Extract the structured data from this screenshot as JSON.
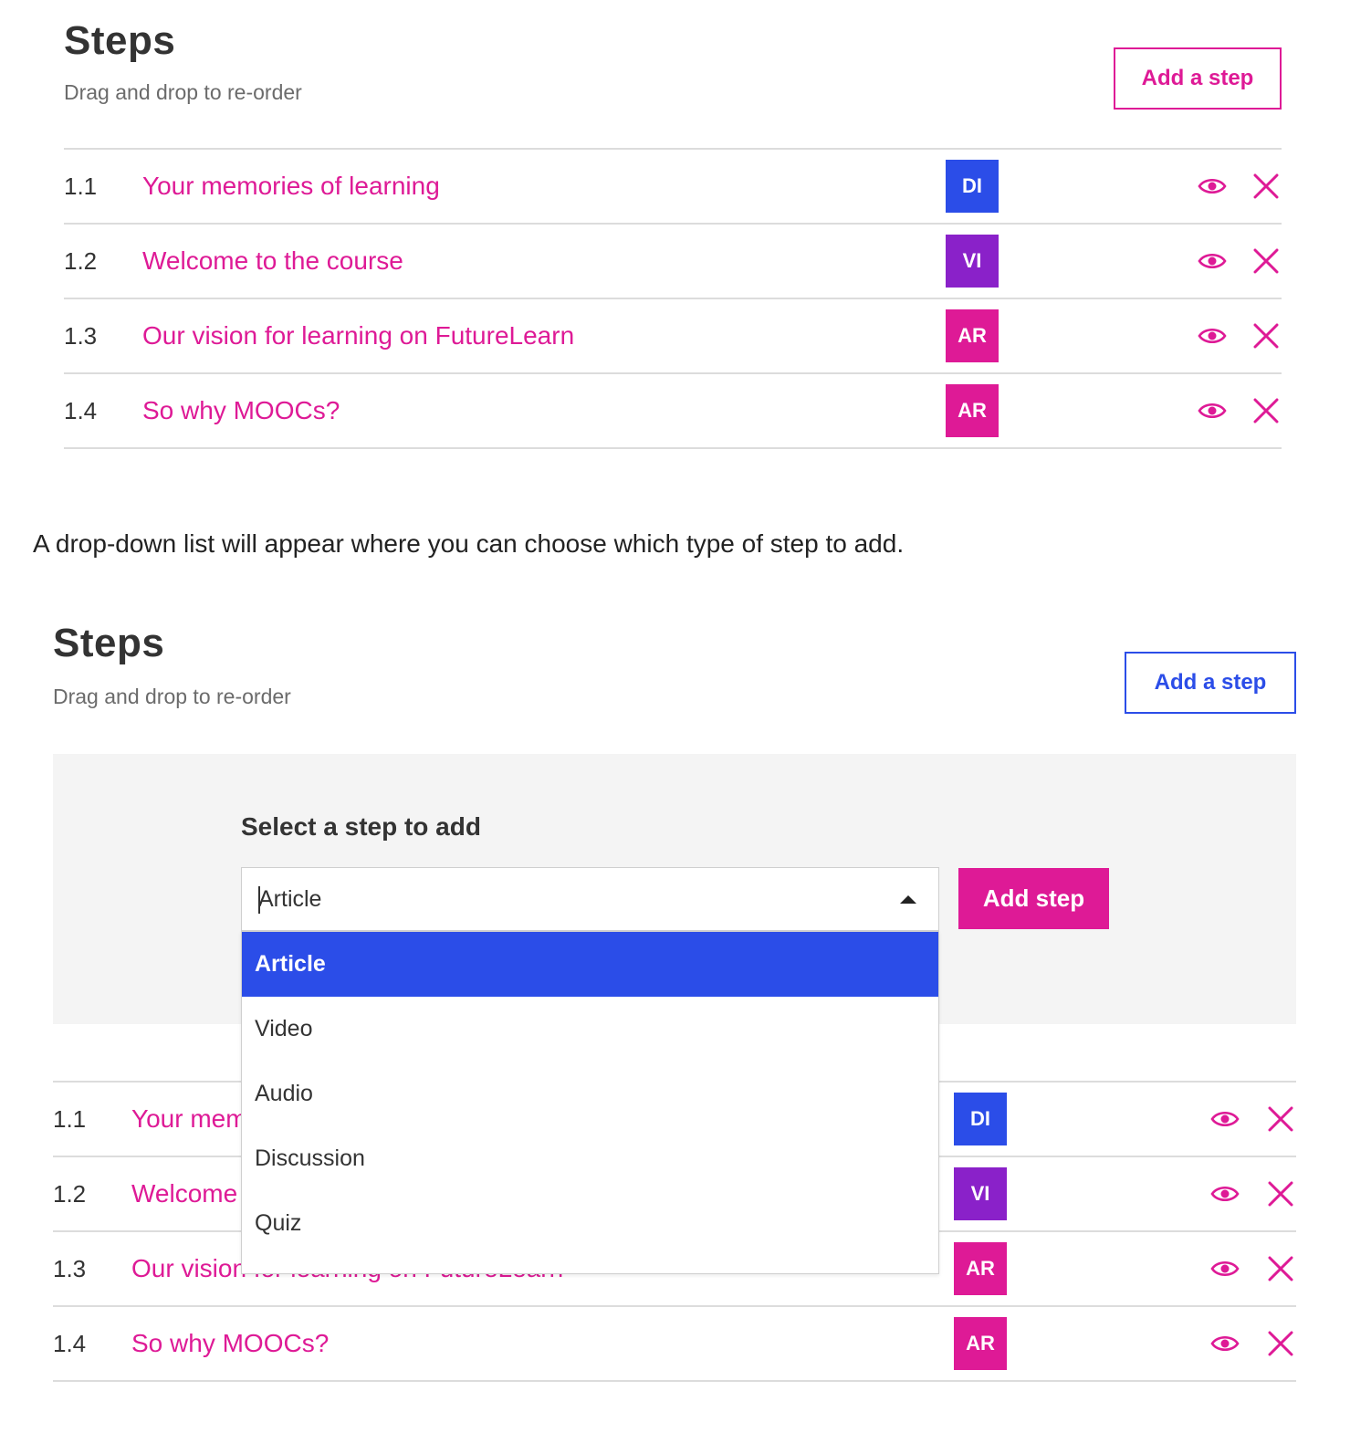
{
  "panel1": {
    "title": "Steps",
    "subtitle": "Drag and drop to re-order",
    "add_button": "Add a step",
    "add_button_color": "#de1a96",
    "steps": [
      {
        "num": "1.1",
        "title": "Your memories of learning",
        "badge": "DI",
        "badge_color": "#2b4de8"
      },
      {
        "num": "1.2",
        "title": "Welcome to the course",
        "badge": "VI",
        "badge_color": "#8a21c9"
      },
      {
        "num": "1.3",
        "title": "Our vision for learning on FutureLearn",
        "badge": "AR",
        "badge_color": "#de1a96"
      },
      {
        "num": "1.4",
        "title": "So why MOOCs?",
        "badge": "AR",
        "badge_color": "#de1a96"
      }
    ]
  },
  "description": "A drop-down list will appear where you can choose which type of step to add.",
  "panel2": {
    "title": "Steps",
    "subtitle": "Drag and drop to re-order",
    "add_button": "Add a step",
    "add_button_color": "#2b4de8",
    "form": {
      "label": "Select a step to add",
      "selected_value": "Article",
      "submit_label": "Add step",
      "options": [
        "Article",
        "Video",
        "Audio",
        "Discussion",
        "Quiz"
      ],
      "active_option": "Article"
    },
    "steps": [
      {
        "num": "1.1",
        "title": "Your memories of learning",
        "badge": "DI",
        "badge_color": "#2b4de8"
      },
      {
        "num": "1.2",
        "title": "Welcome to the course",
        "badge": "VI",
        "badge_color": "#8a21c9"
      },
      {
        "num": "1.3",
        "title": "Our vision for learning on FutureLearn",
        "badge": "AR",
        "badge_color": "#de1a96"
      },
      {
        "num": "1.4",
        "title": "So why MOOCs?",
        "badge": "AR",
        "badge_color": "#de1a96"
      }
    ]
  },
  "icons": {
    "preview": "eye-icon",
    "remove": "close-icon"
  },
  "colors": {
    "pink": "#de1a96",
    "blue": "#2b4de8",
    "purple": "#8a21c9",
    "divider": "#dcdcdc",
    "form_bg": "#f4f4f4"
  }
}
